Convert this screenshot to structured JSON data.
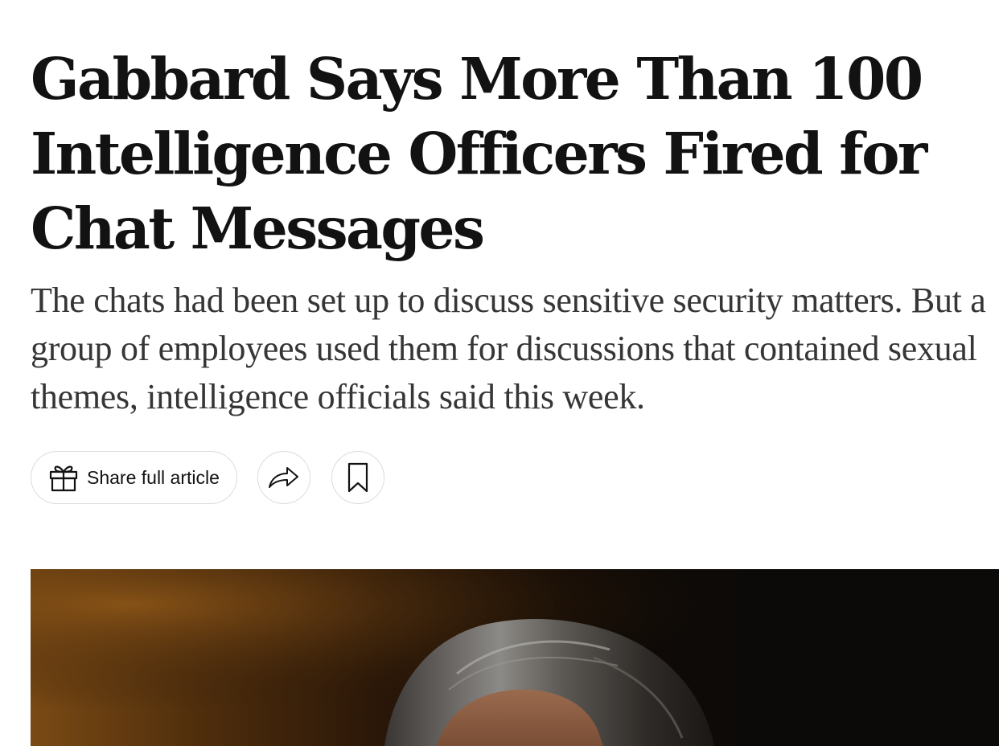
{
  "article": {
    "headline": "Gabbard Says More Than 100 Intelligence Officers Fired for Chat Messages",
    "summary": "The chats had been set up to discuss sensitive security matters. But a group of employees used them for discussions that contained sexual themes, intelligence officials said this week."
  },
  "actions": {
    "share_full_label": "Share full article",
    "share_full_icon": "gift-icon",
    "share_icon": "share-arrow-icon",
    "save_icon": "bookmark-icon"
  },
  "colors": {
    "text": "#121212",
    "summary_text": "#363636",
    "button_border": "#dcdcdc"
  }
}
